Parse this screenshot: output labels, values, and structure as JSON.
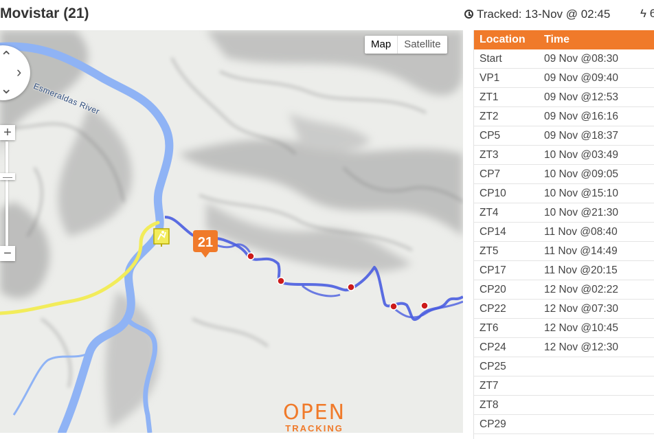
{
  "header": {
    "team_title": "Movistar (21)",
    "tracked_text": "Tracked: 13-Nov @ 02:45",
    "clock_icon": "clock-icon",
    "bolt_text": "ϟ 6"
  },
  "map": {
    "map_type_options": [
      "Map",
      "Satellite"
    ],
    "selected_map_type": "Map",
    "river_label": "Esmeraldas River",
    "marker_label": "21",
    "marker_color": "#f07a2a",
    "route_color": "#4a5de0",
    "river_color": "#8fb3f5",
    "trail_color": "#f2ec5a",
    "start_icon": "start-flag-icon",
    "zoom_in": "+",
    "zoom_out": "−",
    "logo_line1": "OPEN",
    "logo_line2": "TRACKING"
  },
  "checkpoints": {
    "headers": [
      "Location",
      "Time"
    ],
    "header_color": "#f07a2a",
    "rows": [
      {
        "location": "Start",
        "time": "09 Nov @08:30"
      },
      {
        "location": "VP1",
        "time": "09 Nov @09:40"
      },
      {
        "location": "ZT1",
        "time": "09 Nov @12:53"
      },
      {
        "location": "ZT2",
        "time": "09 Nov @16:16"
      },
      {
        "location": "CP5",
        "time": "09 Nov @18:37"
      },
      {
        "location": "ZT3",
        "time": "10 Nov @03:49"
      },
      {
        "location": "CP7",
        "time": "10 Nov @09:05"
      },
      {
        "location": "CP10",
        "time": "10 Nov @15:10"
      },
      {
        "location": "ZT4",
        "time": "10 Nov @21:30"
      },
      {
        "location": "CP14",
        "time": "11 Nov @08:40"
      },
      {
        "location": "ZT5",
        "time": "11 Nov @14:49"
      },
      {
        "location": "CP17",
        "time": "11 Nov @20:15"
      },
      {
        "location": "CP20",
        "time": "12 Nov @02:22"
      },
      {
        "location": "CP22",
        "time": "12 Nov @07:30"
      },
      {
        "location": "ZT6",
        "time": "12 Nov @10:45"
      },
      {
        "location": "CP24",
        "time": "12 Nov @12:30"
      },
      {
        "location": "CP25",
        "time": ""
      },
      {
        "location": "ZT7",
        "time": ""
      },
      {
        "location": "ZT8",
        "time": ""
      },
      {
        "location": "CP29",
        "time": ""
      }
    ]
  }
}
